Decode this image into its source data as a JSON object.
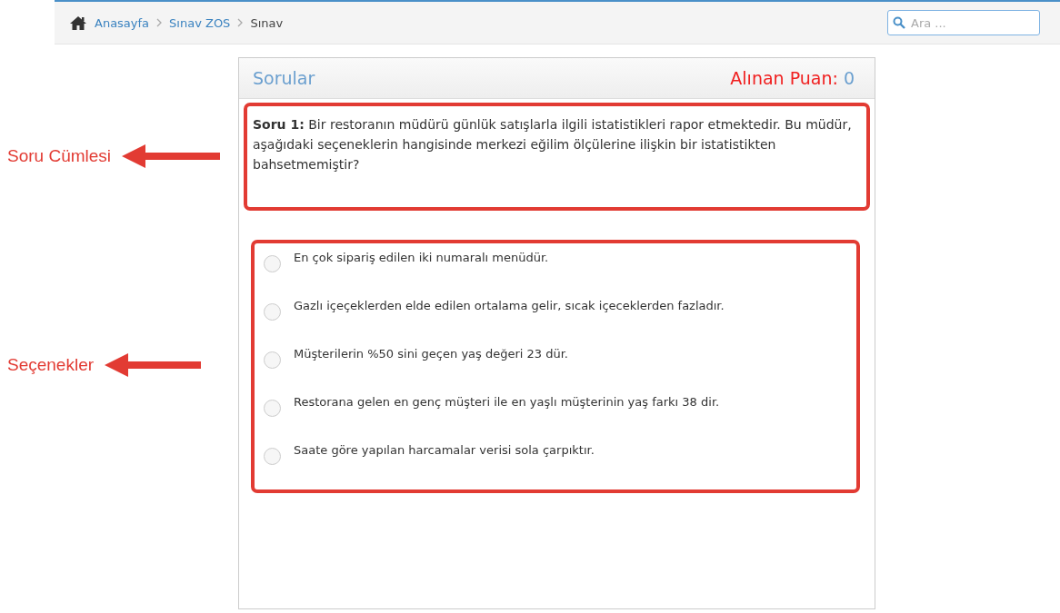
{
  "breadcrumb": [
    {
      "label": "Anasayfa",
      "kind": "home"
    },
    {
      "label": "Sınav ZOS",
      "kind": "link"
    },
    {
      "label": "Sınav",
      "kind": "current"
    }
  ],
  "search": {
    "placeholder": "Ara ..."
  },
  "panel": {
    "title": "Sorular",
    "score_label": "Alınan Puan:",
    "score": "0"
  },
  "question": {
    "text": "**Soru 1:** Bir restoranın müdürü günlük satışlarla ilgili istatistikleri rapor etmektedir. Bu müdür, aşağıdaki seçeneklerin hangisinde merkezi eğilim ölçülerine ilişkin bir istatistikten bahsetmemiştir?"
  },
  "options": [
    {
      "text": "En çok sipariş edilen iki numaralı menüdür.",
      "selected": false
    },
    {
      "text": "Gazlı içeçeklerden elde edilen ortalama gelir, sıcak içeceklerden fazladır.",
      "selected": false
    },
    {
      "text": "Müşterilerin %50 sini geçen yaş değeri 23 dür.",
      "selected": false
    },
    {
      "text": "Restorana gelen en genç müşteri ile en yaşlı müşterinin yaş farkı 38 dir.",
      "selected": false
    },
    {
      "text": "Saate göre yapılan harcamalar verisi sola çarpıktır.",
      "selected": false
    }
  ],
  "annotations": [
    {
      "label": "Soru Cümlesi"
    },
    {
      "label": "Seçenekler"
    }
  ]
}
